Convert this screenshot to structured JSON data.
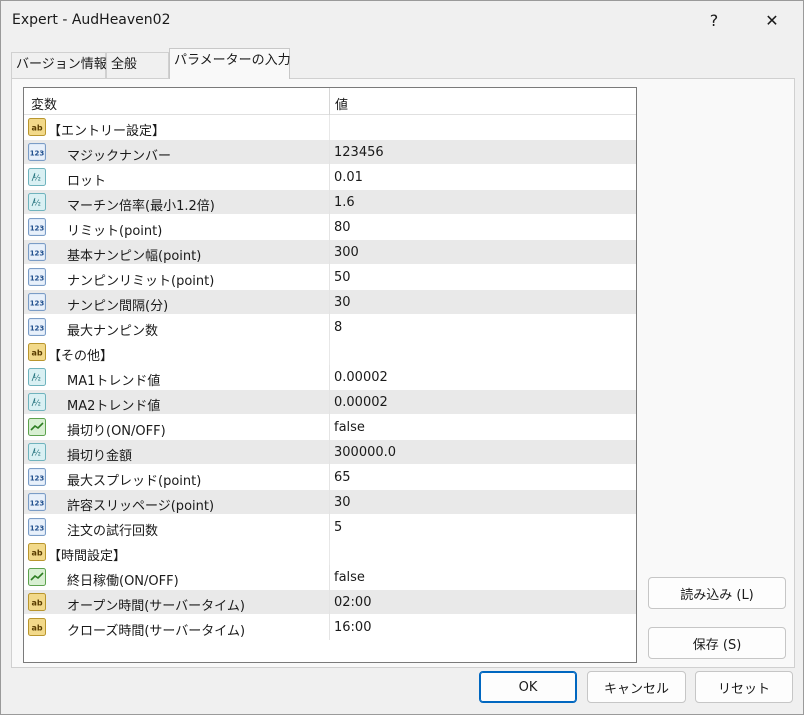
{
  "window": {
    "title": "Expert - AudHeaven02",
    "help_label": "?",
    "close_label": "✕"
  },
  "tabs": [
    {
      "label": "バージョン情報"
    },
    {
      "label": "全般"
    },
    {
      "label": "パラメーターの入力",
      "active": true
    }
  ],
  "grid": {
    "header": {
      "col1": "変数",
      "col2": "値"
    },
    "rows": [
      {
        "icon": "ab-string-icon",
        "name": "【エントリー設定】",
        "value": "",
        "group": true
      },
      {
        "icon": "int-123-icon",
        "name": "マジックナンバー",
        "value": "123456"
      },
      {
        "icon": "double-half-icon",
        "name": "ロット",
        "value": "0.01"
      },
      {
        "icon": "double-half-icon",
        "name": "マーチン倍率(最小1.2倍)",
        "value": "1.6"
      },
      {
        "icon": "int-123-icon",
        "name": "リミット(point)",
        "value": "80"
      },
      {
        "icon": "int-123-icon",
        "name": "基本ナンピン幅(point)",
        "value": "300"
      },
      {
        "icon": "int-123-icon",
        "name": "ナンピンリミット(point)",
        "value": "50"
      },
      {
        "icon": "int-123-icon",
        "name": "ナンピン間隔(分)",
        "value": "30"
      },
      {
        "icon": "int-123-icon",
        "name": "最大ナンピン数",
        "value": "8"
      },
      {
        "icon": "ab-string-icon",
        "name": "【その他】",
        "value": "",
        "group": true
      },
      {
        "icon": "double-half-icon",
        "name": "MA1トレンド値",
        "value": "0.00002"
      },
      {
        "icon": "double-half-icon",
        "name": "MA2トレンド値",
        "value": "0.00002"
      },
      {
        "icon": "bool-toggle-icon",
        "name": "損切り(ON/OFF)",
        "value": "false"
      },
      {
        "icon": "double-half-icon",
        "name": "損切り金額",
        "value": "300000.0"
      },
      {
        "icon": "int-123-icon",
        "name": "最大スプレッド(point)",
        "value": "65"
      },
      {
        "icon": "int-123-icon",
        "name": "許容スリッページ(point)",
        "value": "30"
      },
      {
        "icon": "int-123-icon",
        "name": "注文の試行回数",
        "value": "5"
      },
      {
        "icon": "ab-string-icon",
        "name": "【時間設定】",
        "value": "",
        "group": true
      },
      {
        "icon": "bool-toggle-icon",
        "name": "終日稼働(ON/OFF)",
        "value": "false"
      },
      {
        "icon": "ab-string-icon",
        "name": "オープン時間(サーバータイム)",
        "value": "02:00"
      },
      {
        "icon": "ab-string-icon",
        "name": "クローズ時間(サーバータイム)",
        "value": "16:00"
      }
    ]
  },
  "buttons": {
    "load": "読み込み (L)",
    "save": "保存 (S)",
    "ok": "OK",
    "cancel": "キャンセル",
    "reset": "リセット"
  },
  "colors": {
    "accent": "#0067c0",
    "row_alt": "#e9e9e9"
  }
}
